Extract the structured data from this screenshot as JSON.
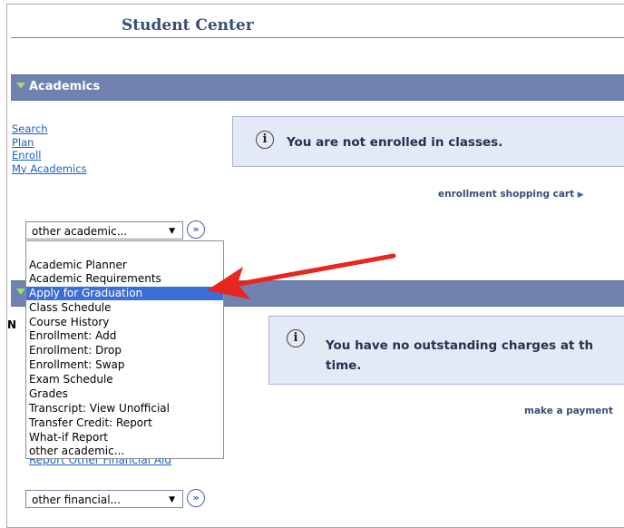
{
  "page": {
    "title": "Student Center"
  },
  "academics": {
    "header": "Academics",
    "links": [
      "Search",
      "Plan",
      "Enroll",
      "My Academics"
    ],
    "message": "You are not enrolled in classes.",
    "cart_link": "enrollment shopping cart",
    "select_value": "other academic...",
    "dropdown_options": [
      "Academic Planner",
      "Academic Requirements",
      "Apply for Graduation",
      "Class Schedule",
      "Course History",
      "Enrollment: Add",
      "Enrollment: Drop",
      "Enrollment: Swap",
      "Exam Schedule",
      "Grades",
      "Transcript: View Unofficial",
      "Transfer Credit: Report",
      "What-if Report",
      "other academic..."
    ],
    "highlighted_option": "Apply for Graduation"
  },
  "finances": {
    "partial_letter": "N",
    "message_line1": "You have no outstanding charges at th",
    "message_line2": "time.",
    "payment_link": "make a payment",
    "partial_link": "Report Other Financial Aid",
    "select_value": "other financial..."
  },
  "annotation": {
    "arrow_color": "#e8251f"
  },
  "colors": {
    "section_bar": "#7181b0",
    "link": "#1a5fc9",
    "highlight": "#3c6ed7",
    "message_bg": "#e3e9f5"
  }
}
